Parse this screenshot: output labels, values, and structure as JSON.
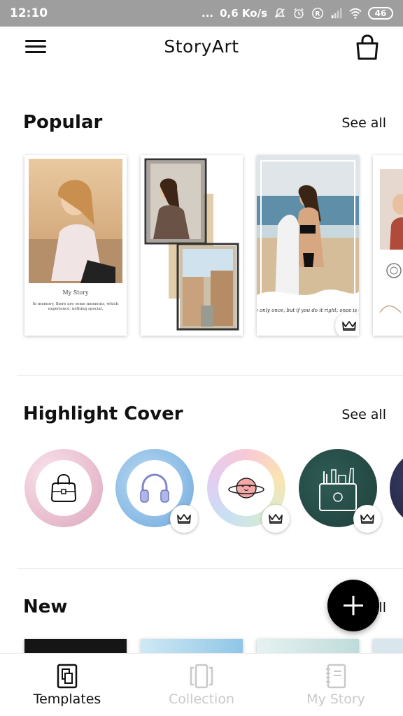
{
  "status_bar": {
    "time": "12:10",
    "dots": "...",
    "speed": "0,6 Ko/s",
    "battery": "46",
    "icons": [
      "mute-bell-icon",
      "alarm-icon",
      "registered-icon",
      "signal-icon",
      "wifi-icon",
      "battery-icon"
    ]
  },
  "app_bar": {
    "title": "StoryArt",
    "menu_icon": "hamburger-menu-icon",
    "bag_icon": "shopping-bag-icon"
  },
  "popular": {
    "title": "Popular",
    "see_all": "See all",
    "cards": [
      {
        "caption_title": "My Story",
        "caption_text": "In memory, there are some moments, which experience, nothing special.",
        "premium": false
      },
      {
        "premium": false
      },
      {
        "caption_text": "You live only once, but if you do it right, once is enough",
        "premium": true
      },
      {
        "premium": false
      }
    ]
  },
  "highlight": {
    "title": "Highlight Cover",
    "see_all": "See all",
    "covers": [
      {
        "icon": "handbag-icon",
        "premium": false
      },
      {
        "icon": "headphones-icon",
        "premium": true
      },
      {
        "icon": "planet-icon",
        "premium": true
      },
      {
        "icon": "makeup-bag-icon",
        "premium": true
      }
    ]
  },
  "new_section": {
    "title": "New",
    "see_all": "See all"
  },
  "fab": {
    "icon": "plus-icon"
  },
  "bottom_nav": [
    {
      "label": "Templates",
      "icon": "templates-icon",
      "active": true
    },
    {
      "label": "Collection",
      "icon": "collection-icon",
      "active": false
    },
    {
      "label": "My Story",
      "icon": "notebook-icon",
      "active": false
    }
  ],
  "colors": {
    "status_bar": "#9e9e9e",
    "text": "#111111",
    "inactive": "#c9c9c9",
    "fab": "#000000"
  }
}
